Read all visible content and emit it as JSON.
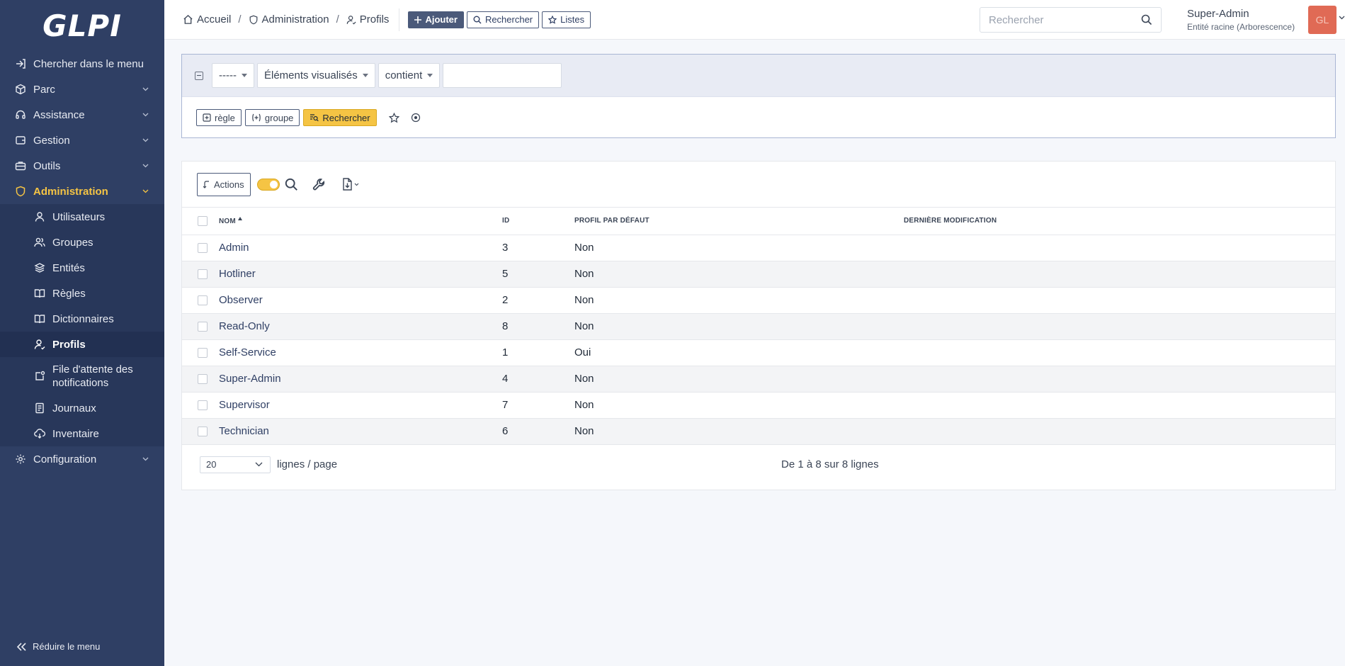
{
  "app": {
    "logo": "GLPI"
  },
  "sidebar": {
    "items": [
      {
        "label": "Chercher dans le menu"
      },
      {
        "label": "Parc"
      },
      {
        "label": "Assistance"
      },
      {
        "label": "Gestion"
      },
      {
        "label": "Outils"
      },
      {
        "label": "Administration"
      },
      {
        "label": "Configuration"
      }
    ],
    "admin_sub": [
      {
        "label": "Utilisateurs"
      },
      {
        "label": "Groupes"
      },
      {
        "label": "Entités"
      },
      {
        "label": "Règles"
      },
      {
        "label": "Dictionnaires"
      },
      {
        "label": "Profils"
      },
      {
        "label": "File d'attente des notifications"
      },
      {
        "label": "Journaux"
      },
      {
        "label": "Inventaire"
      }
    ],
    "reduce_label": "Réduire le menu"
  },
  "header": {
    "breadcrumb": [
      "Accueil",
      "Administration",
      "Profils"
    ],
    "add_label": "Ajouter",
    "search_label": "Rechercher",
    "lists_label": "Listes",
    "global_search_placeholder": "Rechercher",
    "user_name": "Super-Admin",
    "user_entity": "Entité racine (Arborescence)",
    "avatar_initials": "GL"
  },
  "criteria": {
    "field_select": "-----",
    "item_select": "Éléments visualisés",
    "operator_select": "contient",
    "value": "",
    "rule_label": "règle",
    "group_label": "groupe",
    "search_label": "Rechercher"
  },
  "results": {
    "actions_label": "Actions",
    "columns": [
      "Nom",
      "ID",
      "Profil par défaut",
      "Dernière modification"
    ],
    "rows": [
      {
        "name": "Admin",
        "id": "3",
        "default": "Non",
        "modified": ""
      },
      {
        "name": "Hotliner",
        "id": "5",
        "default": "Non",
        "modified": ""
      },
      {
        "name": "Observer",
        "id": "2",
        "default": "Non",
        "modified": ""
      },
      {
        "name": "Read-Only",
        "id": "8",
        "default": "Non",
        "modified": ""
      },
      {
        "name": "Self-Service",
        "id": "1",
        "default": "Oui",
        "modified": ""
      },
      {
        "name": "Super-Admin",
        "id": "4",
        "default": "Non",
        "modified": ""
      },
      {
        "name": "Supervisor",
        "id": "7",
        "default": "Non",
        "modified": ""
      },
      {
        "name": "Technician",
        "id": "6",
        "default": "Non",
        "modified": ""
      }
    ],
    "per_page": "20",
    "per_page_label": "lignes / page",
    "count_text": "De 1 à 8 sur 8 lignes"
  },
  "colors": {
    "sidebar": "#2f3f64",
    "accent": "#f5c444",
    "avatar": "#e06a55"
  }
}
